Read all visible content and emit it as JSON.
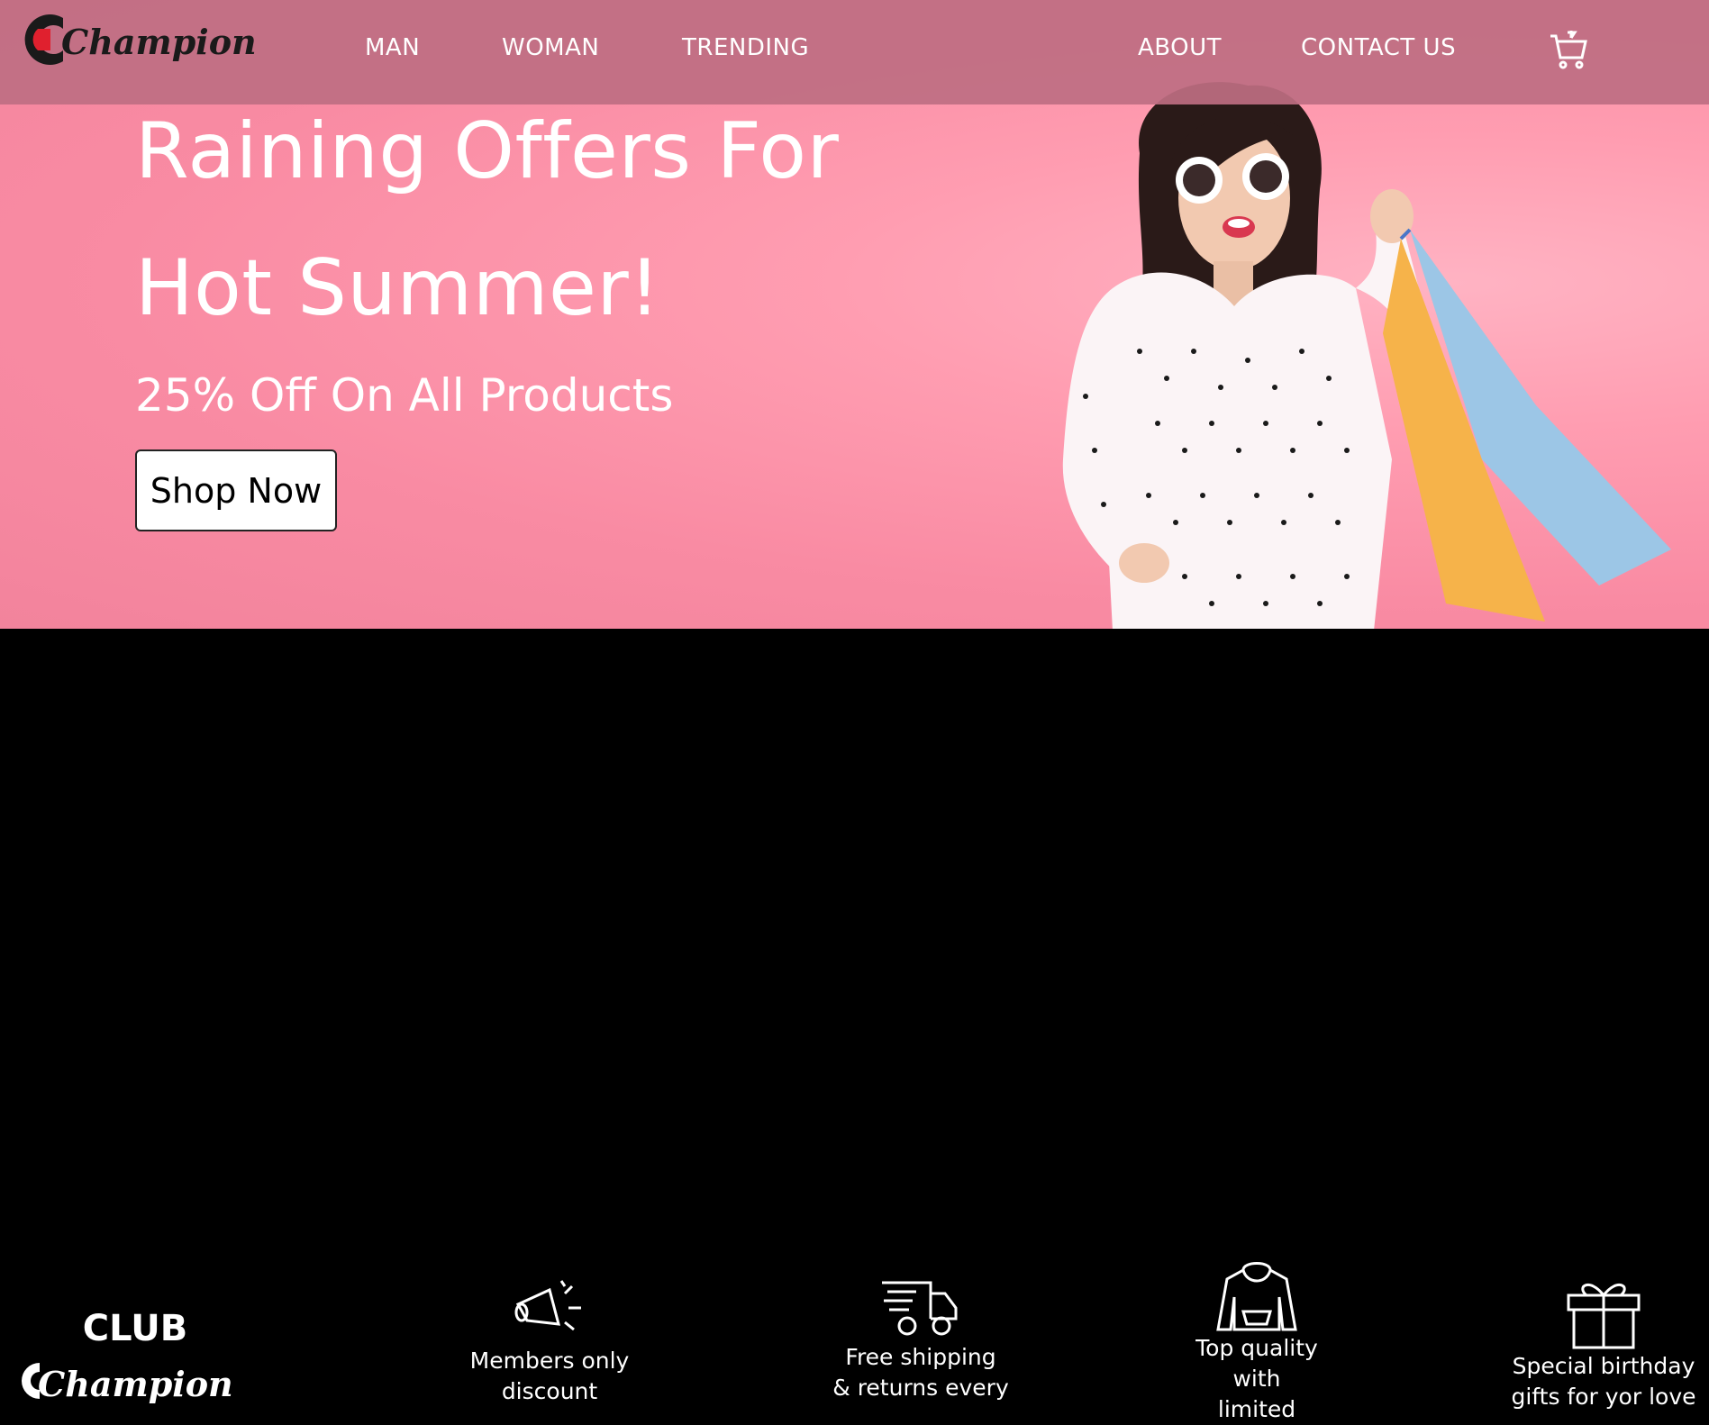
{
  "brand": {
    "name": "Champion",
    "club_label": "CLUB"
  },
  "nav": {
    "items": [
      "MAN",
      "WOMAN",
      "TRENDING"
    ],
    "right_items": [
      "ABOUT",
      "CONTACT US"
    ],
    "cart_icon": "cart-icon"
  },
  "hero": {
    "headline_line1": "Raining Offers For",
    "headline_line2": "Hot Summer!",
    "subheadline": "25% Off On All Products",
    "cta_label": "Shop Now"
  },
  "features": [
    {
      "icon": "megaphone-icon",
      "line1": "Members only",
      "line2": "discount"
    },
    {
      "icon": "truck-icon",
      "line1": "Free shipping",
      "line2": "& returns every"
    },
    {
      "icon": "hoodie-icon",
      "line1": "Top quality",
      "line2": "with",
      "line3": "limited"
    },
    {
      "icon": "gift-icon",
      "line1": "Special birthday",
      "line2": "gifts for yor love"
    }
  ],
  "colors": {
    "hero_bg": "#f98ba3",
    "navbar_bg": "#be6e82",
    "features_bg": "#000000",
    "logo_red": "#e0202e"
  }
}
